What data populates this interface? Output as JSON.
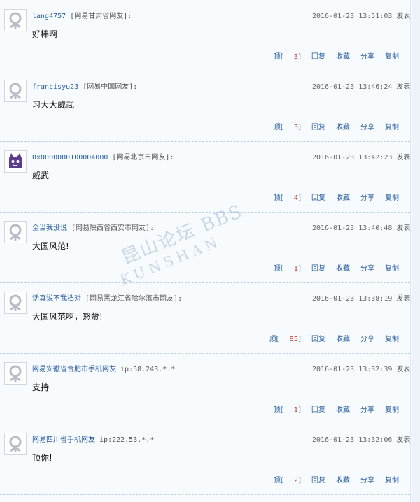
{
  "comments": [
    {
      "user": "lang4757",
      "loc": "[网易甘肃省网友]:",
      "time": "2016-01-23 13:51:03",
      "post": "发表",
      "content": "好棒啊",
      "up": "3",
      "avatar": "default-avatar-icon"
    },
    {
      "user": "francisyu23",
      "loc": "[网易中国网友]:",
      "time": "2016-01-23 13:46:24",
      "post": "发表",
      "content": "习大大威武",
      "up": "3",
      "avatar": "default-avatar-icon"
    },
    {
      "user": "0x0000000100004000",
      "loc": "[网易北京市网友]:",
      "time": "2016-01-23 13:42:23",
      "post": "发表",
      "content": "威武",
      "up": "4",
      "avatar": "purple-cat-avatar-icon"
    },
    {
      "user": "全当我没说",
      "loc": "[网易陕西省西安市网友]:",
      "time": "2016-01-23 13:40:48",
      "post": "发表",
      "content": "大国风范!",
      "up": "1",
      "avatar": "default-avatar-icon"
    },
    {
      "user": "话真说不我挡对",
      "loc": "[网易黑龙江省哈尔滨市网友]:",
      "time": "2016-01-23 13:38:19",
      "post": "发表",
      "content": "大国风范啊，怒赞!",
      "up": "85",
      "avatar": "default-avatar-icon"
    },
    {
      "user": "网易安徽省合肥市手机网友",
      "loc": "ip:58.243.*.*",
      "time": "2016-01-23 13:32:39",
      "post": "发表",
      "content": "支持",
      "up": "1",
      "avatar": "default-avatar-icon"
    },
    {
      "user": "网易四川省手机网友",
      "loc": "ip:222.53.*.*",
      "time": "2016-01-23 13:32:06",
      "post": "发表",
      "content": "顶你!",
      "up": "2",
      "avatar": "default-avatar-icon"
    }
  ],
  "actions": {
    "up": "顶",
    "reply": "回复",
    "fav": "收藏",
    "share": "分享",
    "copy": "复制"
  },
  "watermark": {
    "top": "昆山论坛 BBS",
    "bottom": "KUNSHAN"
  }
}
